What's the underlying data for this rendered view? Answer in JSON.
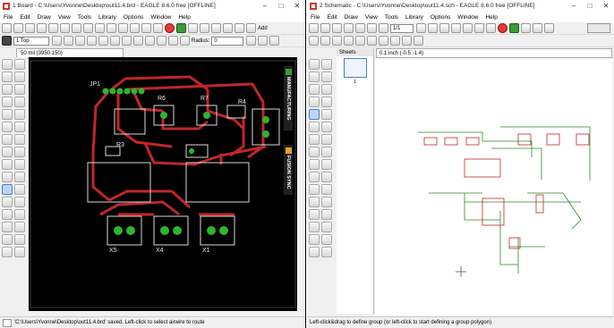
{
  "board_window": {
    "title": "1 Board - C:\\Users\\Yvonne\\Desktop\\out11.4.brd - EAGLE 8.6.0 free [OFFLINE]",
    "menu": [
      "File",
      "Edit",
      "Draw",
      "View",
      "Tools",
      "Library",
      "Options",
      "Window",
      "Help"
    ],
    "layer_select": "1 Top",
    "radius_label": "Radius:",
    "radius_value": "0",
    "add_label": "Add",
    "coord_readout": "50 mil (3950 150)",
    "manufacturing_tab": "MANUFACTURING",
    "fusion_sync_tab": "FUSION SYNC",
    "status_text": "'C:\\Users\\Yvonne\\Desktop\\out11.4.brd' saved. Left-click to select airwire to route",
    "board_labels": {
      "jp1": "JP1",
      "r6": "R6",
      "r7": "R7",
      "r4": "R4",
      "r3": "R3",
      "x5": "X5",
      "x4": "X4",
      "x1": "X1"
    },
    "colors": {
      "canvas": "#000000",
      "trace": "#c0262a",
      "pad": "#2fb32f",
      "silk": "#d8d8d8"
    }
  },
  "schematic_window": {
    "title": "2 Schematic - C:\\Users\\Yvonne\\Desktop\\out11.4.sch - EAGLE 8.6.0 free [OFFLINE]",
    "menu": [
      "File",
      "Edit",
      "Draw",
      "View",
      "Tools",
      "Library",
      "Options",
      "Window",
      "Help"
    ],
    "sheet_select": "1/1",
    "sheets_header": "Sheets",
    "sheet_number": "1",
    "coord_readout": "0.1 inch (-0.5 -1.4)",
    "status_text": "Left-click&drag to define group (or left-click to start defining a group polygon)",
    "colors": {
      "net": "#2a8a2a",
      "part": "#c0262a",
      "frame": "#c0262a"
    }
  }
}
